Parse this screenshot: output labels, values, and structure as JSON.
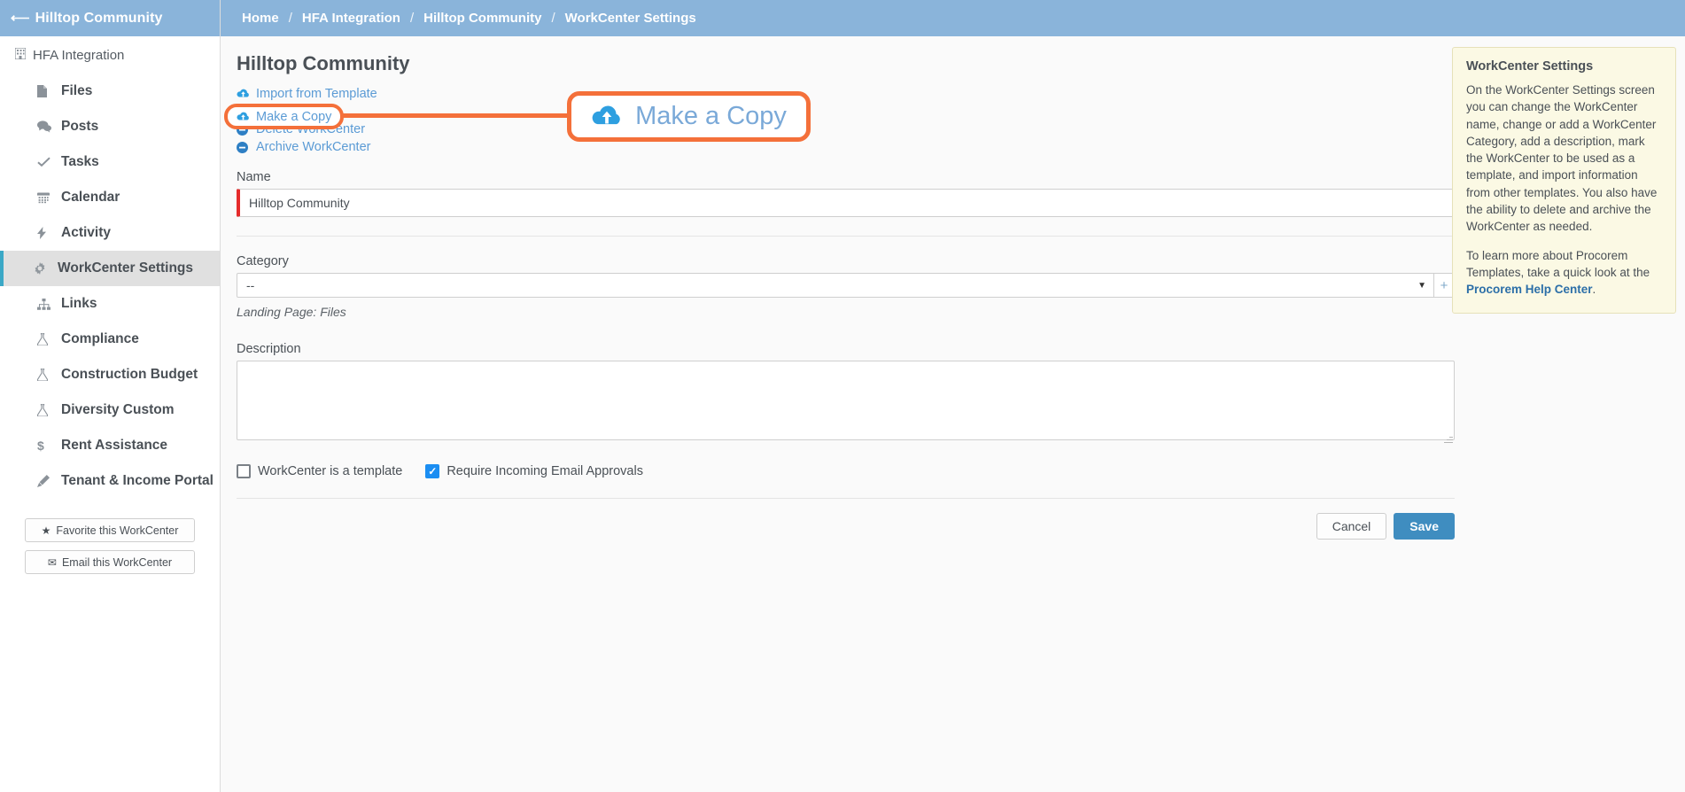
{
  "sidebar": {
    "header": {
      "title": "Hilltop Community",
      "back_icon": "arrow-left-icon"
    },
    "root": {
      "label": "HFA Integration",
      "icon": "building-icon"
    },
    "items": [
      {
        "label": "Files",
        "icon": "file-icon",
        "active": false
      },
      {
        "label": "Posts",
        "icon": "comments-icon",
        "active": false
      },
      {
        "label": "Tasks",
        "icon": "check-icon",
        "active": false
      },
      {
        "label": "Calendar",
        "icon": "calendar-icon",
        "active": false
      },
      {
        "label": "Activity",
        "icon": "bolt-icon",
        "active": false
      },
      {
        "label": "WorkCenter Settings",
        "icon": "gear-icon",
        "active": true
      },
      {
        "label": "Links",
        "icon": "sitemap-icon",
        "active": false
      },
      {
        "label": "Compliance",
        "icon": "flask-icon",
        "active": false
      },
      {
        "label": "Construction Budget",
        "icon": "flask-icon",
        "active": false
      },
      {
        "label": "Diversity Custom",
        "icon": "flask-icon",
        "active": false
      },
      {
        "label": "Rent Assistance",
        "icon": "dollar-icon",
        "active": false
      },
      {
        "label": "Tenant & Income Portal",
        "icon": "pencil-icon",
        "active": false
      }
    ],
    "buttons": [
      {
        "label": "Favorite this WorkCenter",
        "icon": "star-icon"
      },
      {
        "label": "Email this WorkCenter",
        "icon": "envelope-icon"
      }
    ]
  },
  "breadcrumb": {
    "separator": "/",
    "items": [
      "Home",
      "HFA Integration",
      "Hilltop Community",
      "WorkCenter Settings"
    ]
  },
  "main": {
    "page_title": "Hilltop Community",
    "action_links": [
      {
        "label": "Import from Template",
        "icon": "cloud-upload-icon"
      },
      {
        "label": "Make a Copy",
        "icon": "cloud-upload-icon"
      },
      {
        "label": "Delete WorkCenter",
        "icon": "minus-circle-icon"
      },
      {
        "label": "Archive WorkCenter",
        "icon": "minus-circle-icon"
      }
    ],
    "name_field": {
      "label": "Name",
      "value": "Hilltop Community",
      "placeholder": "",
      "required": true
    },
    "category_field": {
      "label": "Category",
      "value": "--",
      "add_button_label": "+",
      "chevron_icon": "chevron-down-icon"
    },
    "landing_page_note": "Landing Page: Files",
    "description_field": {
      "label": "Description",
      "value": "",
      "placeholder": ""
    },
    "checkboxes": [
      {
        "label": "WorkCenter is a template",
        "checked": false
      },
      {
        "label": "Require Incoming Email Approvals",
        "checked": true
      }
    ],
    "buttons": {
      "cancel": "Cancel",
      "save": "Save"
    }
  },
  "help_panel": {
    "title": "WorkCenter Settings",
    "paragraph1": "On the WorkCenter Settings screen you can change the WorkCenter name, change or add a WorkCenter Category, add a description, mark the WorkCenter to be used as a template, and import information from other templates. You also have the ability to delete and archive the WorkCenter as needed.",
    "paragraph2_pre": "To learn more about Procorem Templates, take a quick look at the ",
    "paragraph2_link": "Procorem Help Center",
    "paragraph2_post": "."
  },
  "callout": {
    "zoom_label": "Make a Copy",
    "zoom_icon": "cloud-upload-icon",
    "highlight_label": "Make a Copy",
    "accent_color": "#f4703a"
  },
  "colors": {
    "header_blue": "#8ab4da",
    "link_blue": "#5b9bd5",
    "icon_blue": "#2e9fe0",
    "active_accent": "#3ba8c6",
    "required_red": "#e52b2b",
    "save_blue": "#3f8dc0",
    "checkbox_blue": "#1b8ef2",
    "help_bg": "#fbf9e4",
    "callout_orange": "#f4703a"
  }
}
